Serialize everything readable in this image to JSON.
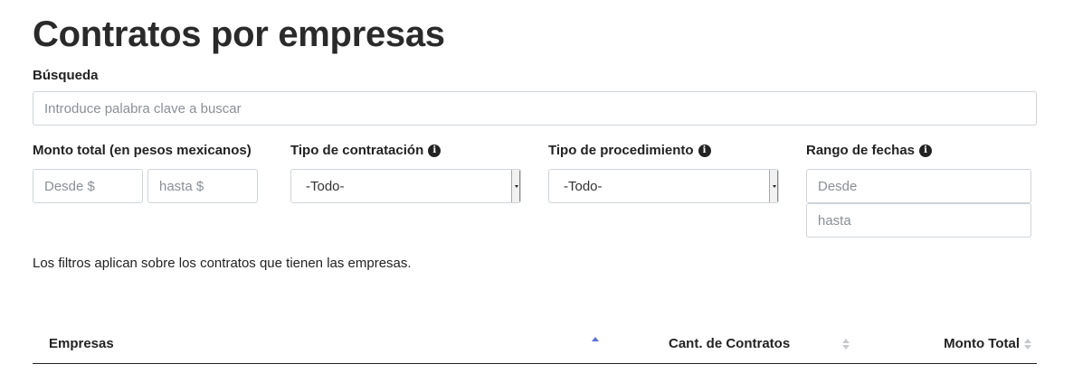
{
  "page": {
    "title": "Contratos por empresas"
  },
  "search": {
    "label": "Búsqueda",
    "placeholder": "Introduce palabra clave a buscar"
  },
  "filters": {
    "amount": {
      "label": "Monto total (en pesos mexicanos)",
      "from_placeholder": "Desde $",
      "to_placeholder": "hasta $"
    },
    "contract_type": {
      "label": "Tipo de contratación",
      "selected": "-Todo-",
      "icon": "info-icon"
    },
    "procedure_type": {
      "label": "Tipo de procedimiento",
      "selected": "-Todo-",
      "icon": "info-icon"
    },
    "date_range": {
      "label": "Rango de fechas",
      "icon": "info-icon",
      "from_placeholder": "Desde",
      "to_placeholder": "hasta"
    },
    "note": "Los filtros aplican sobre los contratos que tienen las empresas."
  },
  "table": {
    "columns": [
      {
        "label": "Empresas",
        "sort": "ascending"
      },
      {
        "label": "Cant. de Contratos",
        "sort": "none"
      },
      {
        "label": "Monto Total",
        "sort": "none"
      }
    ]
  },
  "colors": {
    "sort_active": "#5b6fd6",
    "sort_inactive": "#c7c9cc",
    "border": "#cfd4da",
    "text": "#222222"
  }
}
